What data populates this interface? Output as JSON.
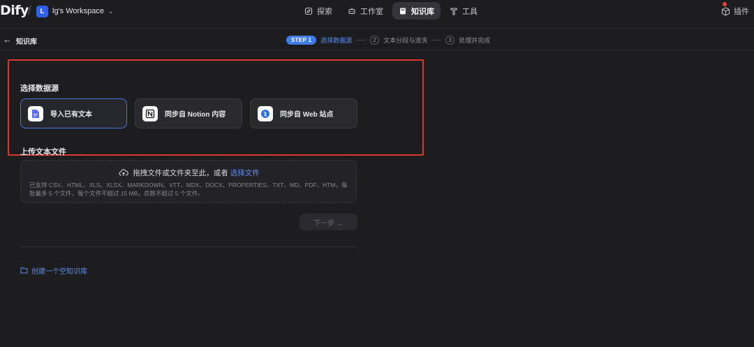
{
  "header": {
    "logo": "Dify",
    "workspace": {
      "avatar_letter": "L",
      "name": "lg's Workspace"
    },
    "nav": [
      {
        "label": "探索",
        "icon": "explore-icon"
      },
      {
        "label": "工作室",
        "icon": "robot-icon"
      },
      {
        "label": "知识库",
        "icon": "book-icon",
        "active": true
      },
      {
        "label": "工具",
        "icon": "hammer-icon"
      }
    ],
    "plugins_label": "插件"
  },
  "subheader": {
    "breadcrumb": "知识库",
    "steps": [
      {
        "badge": "STEP 1",
        "label": "选择数据源",
        "active": true
      },
      {
        "num": "2",
        "label": "文本分段与清洗"
      },
      {
        "num": "3",
        "label": "处理并完成"
      }
    ]
  },
  "main": {
    "data_source_title": "选择数据源",
    "sources": [
      {
        "label": "导入已有文本",
        "selected": true,
        "icon": "file-text-icon"
      },
      {
        "label": "同步自 Notion 内容",
        "selected": false,
        "icon": "notion-icon"
      },
      {
        "label": "同步自 Web 站点",
        "selected": false,
        "icon": "web-icon"
      }
    ],
    "upload_title": "上传文本文件",
    "dropzone": {
      "prompt": "拖拽文件或文件夹至此，或者",
      "link": "选择文件",
      "formats": "已支持 CSV、HTML、XLS、XLSX、MARKDOWN、VTT、MDX、DOCX、PROPERTIES、TXT、MD、PDF、HTM，每批最多 5 个文件，每个文件不超过 15 MB，总数不超过 5 个文件。"
    },
    "next_button": "下一步 →",
    "create_empty": "创建一个空知识库"
  },
  "colors": {
    "accent": "#3f7ee8",
    "highlight_border": "#d8382e",
    "background": "#1d1d20"
  }
}
